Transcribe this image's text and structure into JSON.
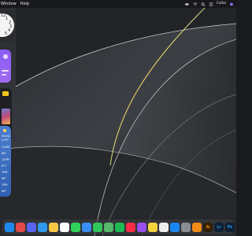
{
  "menubar": {
    "items": [
      "Window",
      "Help"
    ],
    "right_label": "Collai"
  },
  "clock_widget": {
    "numbers": [
      "12",
      "1",
      "2",
      "3",
      "4",
      "5"
    ]
  },
  "weather_widget": {
    "condition": "Sunny",
    "temp_range": "L:59°",
    "hours": [
      "11AM",
      "12PM",
      "1PM",
      "2PM",
      "3PM",
      "4PM",
      "5PM",
      "6PM"
    ],
    "temps": [
      "66°",
      "67°",
      "68°",
      "68°",
      "67°",
      "66°",
      "64°",
      "63°"
    ]
  },
  "dock": {
    "apps": [
      {
        "name": "finder-app",
        "color": "#1e8af0",
        "label": ""
      },
      {
        "name": "launchpad-app",
        "color": "#e54a4a",
        "label": ""
      },
      {
        "name": "discord-app",
        "color": "#5865f2",
        "label": ""
      },
      {
        "name": "safari-app",
        "color": "#2f9bf0",
        "label": ""
      },
      {
        "name": "photos-app",
        "color": "#f6c945",
        "label": ""
      },
      {
        "name": "calendar-app",
        "color": "#ffffff",
        "label": ""
      },
      {
        "name": "messages-app",
        "color": "#2fd158",
        "label": ""
      },
      {
        "name": "mail-app",
        "color": "#3a8df0",
        "label": ""
      },
      {
        "name": "facetime-app",
        "color": "#30c758",
        "label": ""
      },
      {
        "name": "maps-app",
        "color": "#55b86b",
        "label": ""
      },
      {
        "name": "spotify-app",
        "color": "#1db954",
        "label": ""
      },
      {
        "name": "music-app",
        "color": "#fa2d48",
        "label": ""
      },
      {
        "name": "podcasts-app",
        "color": "#9a4ff0",
        "label": ""
      },
      {
        "name": "notes-app",
        "color": "#f5d33d",
        "label": ""
      },
      {
        "name": "reminders-app",
        "color": "#eeeeee",
        "label": ""
      },
      {
        "name": "app-store-app",
        "color": "#1a86f0",
        "label": ""
      },
      {
        "name": "settings-app",
        "color": "#8a8d93",
        "label": ""
      },
      {
        "name": "vlc-app",
        "color": "#f08a17",
        "label": ""
      },
      {
        "name": "illustrator-app",
        "color": "#2f1e05",
        "label": "Ai"
      },
      {
        "name": "lightroom-app",
        "color": "#0f1f35",
        "label": "Lr"
      },
      {
        "name": "photoshop-app",
        "color": "#0f1f35",
        "label": "Ps"
      },
      {
        "name": "folder-app",
        "color": "#5aa0e0",
        "label": ""
      },
      {
        "name": "trash-app",
        "color": "#b0b3b8",
        "label": ""
      }
    ]
  }
}
